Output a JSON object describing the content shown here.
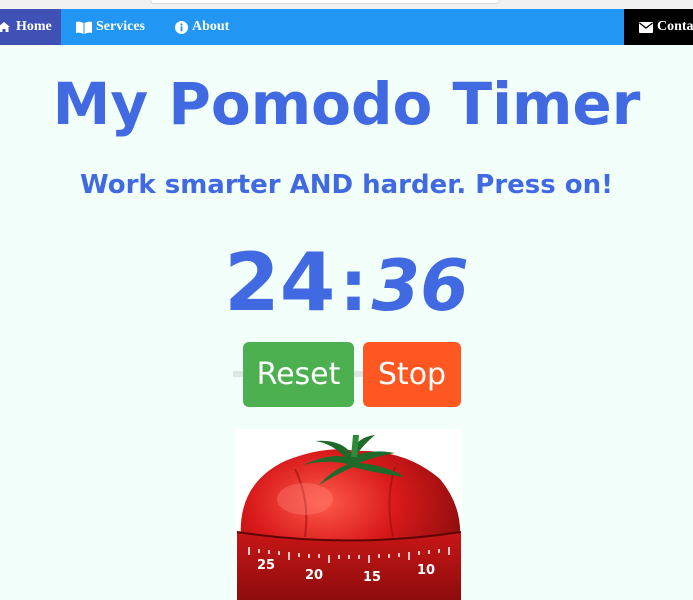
{
  "nav": {
    "home": "Home",
    "services": "Services",
    "about": "About",
    "contact": "Conta"
  },
  "title": "My Pomodo Timer",
  "subtitle": "Work smarter AND harder. Press on!",
  "timer": {
    "minutes": "24",
    "separator": ":",
    "seconds": "36"
  },
  "buttons": {
    "reset": "Reset",
    "stop": "Stop"
  },
  "dial_numbers": [
    "25",
    "20",
    "15",
    "10"
  ],
  "colors": {
    "nav_bg": "#2196f3",
    "home_bg": "#3f51b5",
    "contact_bg": "#000000",
    "text_blue": "#4169e1",
    "reset_green": "#4caf50",
    "stop_orange": "#ff5722",
    "page_bg": "#f3fffa"
  }
}
